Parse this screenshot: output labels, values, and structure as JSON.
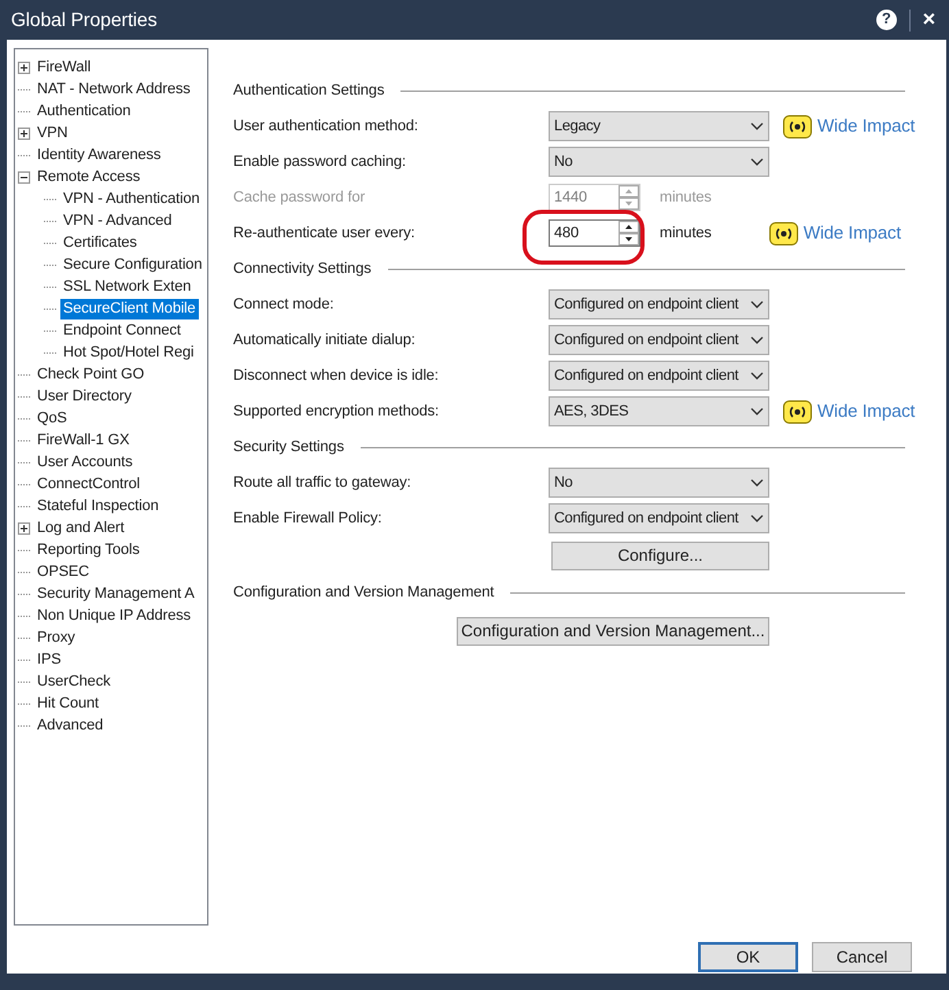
{
  "window": {
    "title": "Global Properties",
    "help": "?",
    "close": "×"
  },
  "tree": [
    {
      "label": "FireWall",
      "expanded": false,
      "selected": false
    },
    {
      "label": "NAT - Network Address",
      "selected": false
    },
    {
      "label": "Authentication",
      "selected": false
    },
    {
      "label": "VPN",
      "expanded": false,
      "selected": false
    },
    {
      "label": "Identity Awareness",
      "selected": false
    },
    {
      "label": "Remote Access",
      "expanded": true,
      "selected": false,
      "children": [
        {
          "label": "VPN - Authentication",
          "selected": false
        },
        {
          "label": "VPN - Advanced",
          "selected": false
        },
        {
          "label": "Certificates",
          "selected": false
        },
        {
          "label": "Secure Configuration",
          "selected": false
        },
        {
          "label": "SSL Network Exten",
          "selected": false
        },
        {
          "label": "SecureClient Mobile",
          "selected": true
        },
        {
          "label": "Endpoint Connect",
          "selected": false
        },
        {
          "label": "Hot Spot/Hotel Regi",
          "selected": false
        }
      ]
    },
    {
      "label": "Check Point GO",
      "selected": false
    },
    {
      "label": "User Directory",
      "selected": false
    },
    {
      "label": "QoS",
      "selected": false
    },
    {
      "label": "FireWall-1 GX",
      "selected": false
    },
    {
      "label": "User Accounts",
      "selected": false
    },
    {
      "label": "ConnectControl",
      "selected": false
    },
    {
      "label": "Stateful Inspection",
      "selected": false
    },
    {
      "label": "Log and Alert",
      "expanded": false,
      "selected": false
    },
    {
      "label": "Reporting Tools",
      "selected": false
    },
    {
      "label": "OPSEC",
      "selected": false
    },
    {
      "label": "Security Management A",
      "selected": false
    },
    {
      "label": "Non Unique IP Address",
      "selected": false
    },
    {
      "label": "Proxy",
      "selected": false
    },
    {
      "label": "IPS",
      "selected": false
    },
    {
      "label": "UserCheck",
      "selected": false
    },
    {
      "label": "Hit Count",
      "selected": false
    },
    {
      "label": "Advanced",
      "selected": false
    }
  ],
  "sections": [
    {
      "title": "Authentication Settings",
      "rows": [
        {
          "kind": "select",
          "label": "User authentication method:",
          "value": "Legacy",
          "wide_impact": "Wide Impact"
        },
        {
          "kind": "select",
          "label": "Enable password caching:",
          "value": "No"
        },
        {
          "kind": "spinner",
          "label": "Cache password for",
          "value": "1440",
          "suffix": "minutes",
          "disabled": true
        },
        {
          "kind": "spinner",
          "label": "Re-authenticate user every:",
          "value": "480",
          "suffix": "minutes",
          "disabled": false,
          "circled": true,
          "wide_impact": "Wide Impact"
        }
      ]
    },
    {
      "title": "Connectivity Settings",
      "rows": [
        {
          "kind": "select",
          "label": "Connect mode:",
          "value": "Configured on endpoint client"
        },
        {
          "kind": "select",
          "label": "Automatically initiate dialup:",
          "value": "Configured on endpoint client"
        },
        {
          "kind": "select",
          "label": "Disconnect when device is idle:",
          "value": "Configured on endpoint client"
        },
        {
          "kind": "select",
          "label": "Supported encryption methods:",
          "value": "AES, 3DES",
          "wide_impact": "Wide Impact"
        }
      ]
    },
    {
      "title": "Security Settings",
      "rows": [
        {
          "kind": "select",
          "label": "Route all traffic to gateway:",
          "value": "No"
        },
        {
          "kind": "select",
          "label": "Enable Firewall Policy:",
          "value": "Configured on endpoint client"
        },
        {
          "kind": "button",
          "value": "Configure..."
        }
      ]
    },
    {
      "title": "Configuration and Version Management",
      "rows": [
        {
          "kind": "wide-button",
          "value": "Configuration and Version Management..."
        }
      ]
    }
  ],
  "buttons": [
    {
      "label": "OK",
      "default": true
    },
    {
      "label": "Cancel",
      "default": false
    }
  ]
}
